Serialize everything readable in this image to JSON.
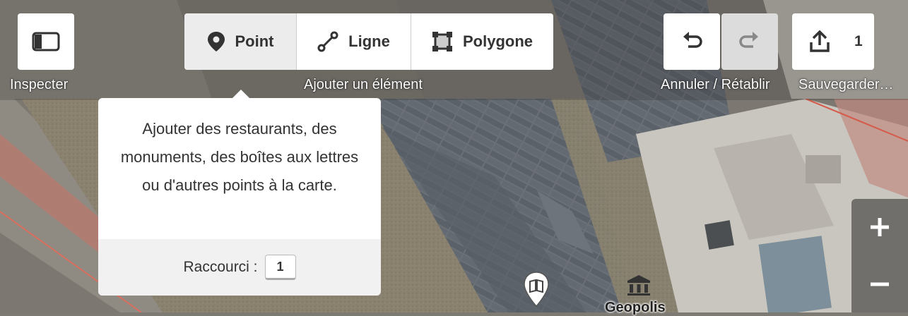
{
  "toolbar": {
    "inspect": {
      "label": "Inspecter",
      "icon": "sidebar-toggle-icon"
    },
    "add_feature": {
      "label": "Ajouter un élément",
      "modes": [
        {
          "label": "Point",
          "icon": "map-marker-icon",
          "active": true
        },
        {
          "label": "Ligne",
          "icon": "line-icon",
          "active": false
        },
        {
          "label": "Polygone",
          "icon": "polygon-icon",
          "active": false
        }
      ]
    },
    "history": {
      "label": "Annuler / Rétablir",
      "undo_icon": "undo-icon",
      "redo_icon": "redo-icon",
      "redo_enabled": false
    },
    "save": {
      "label": "Sauvegarder…",
      "icon": "upload-icon",
      "count": "1"
    }
  },
  "tooltip": {
    "text": "Ajouter des restaurants, des monuments, des boîtes aux lettres ou d'autres points à la carte.",
    "shortcut_label": "Raccourci :",
    "shortcut_key": "1"
  },
  "zoom": {
    "in_icon": "plus-icon",
    "out_icon": "minus-icon"
  },
  "map": {
    "poi_label": "Geopolis",
    "poi_icon": "museum-icon",
    "pin_icon": "book-icon"
  },
  "colors": {
    "button_bg": "#ffffff",
    "active_mode_bg": "#ececec",
    "text": "#333333",
    "disabled": "#dddddd"
  }
}
